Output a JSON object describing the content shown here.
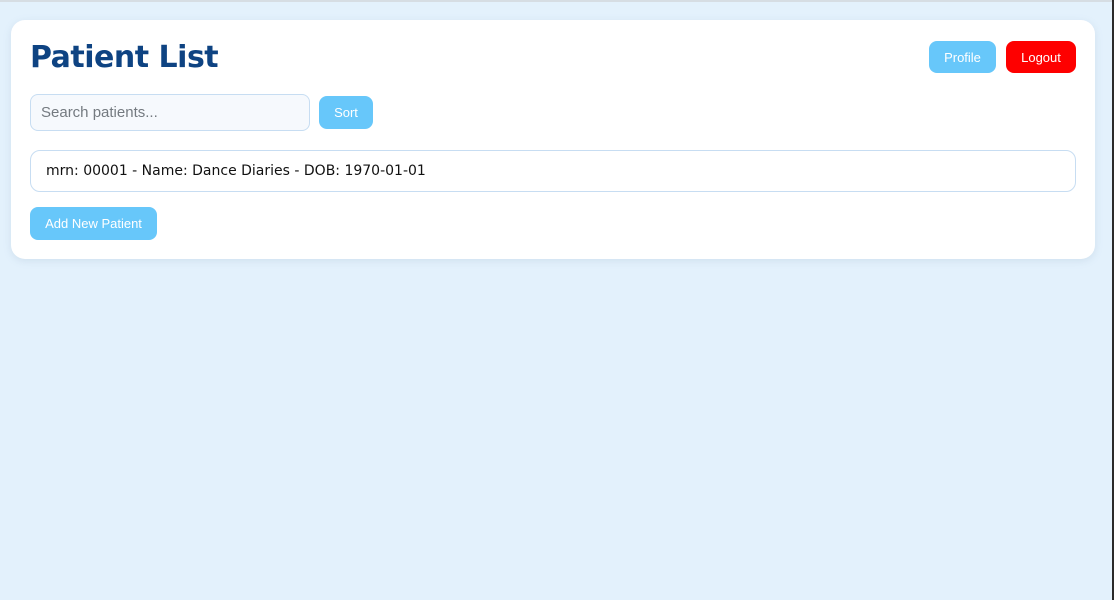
{
  "page": {
    "title": "Patient List"
  },
  "header": {
    "profile_label": "Profile",
    "logout_label": "Logout"
  },
  "search": {
    "placeholder": "Search patients...",
    "value": ""
  },
  "toolbar": {
    "sort_label": "Sort"
  },
  "patients": [
    {
      "text": "mrn: 00001 - Name: Dance Diaries - DOB: 1970-01-01"
    }
  ],
  "actions": {
    "add_patient_label": "Add New Patient"
  },
  "colors": {
    "background": "#e3f1fc",
    "title": "#0e4382",
    "primary_button": "#67c7fa",
    "logout_button": "#fe0000"
  }
}
